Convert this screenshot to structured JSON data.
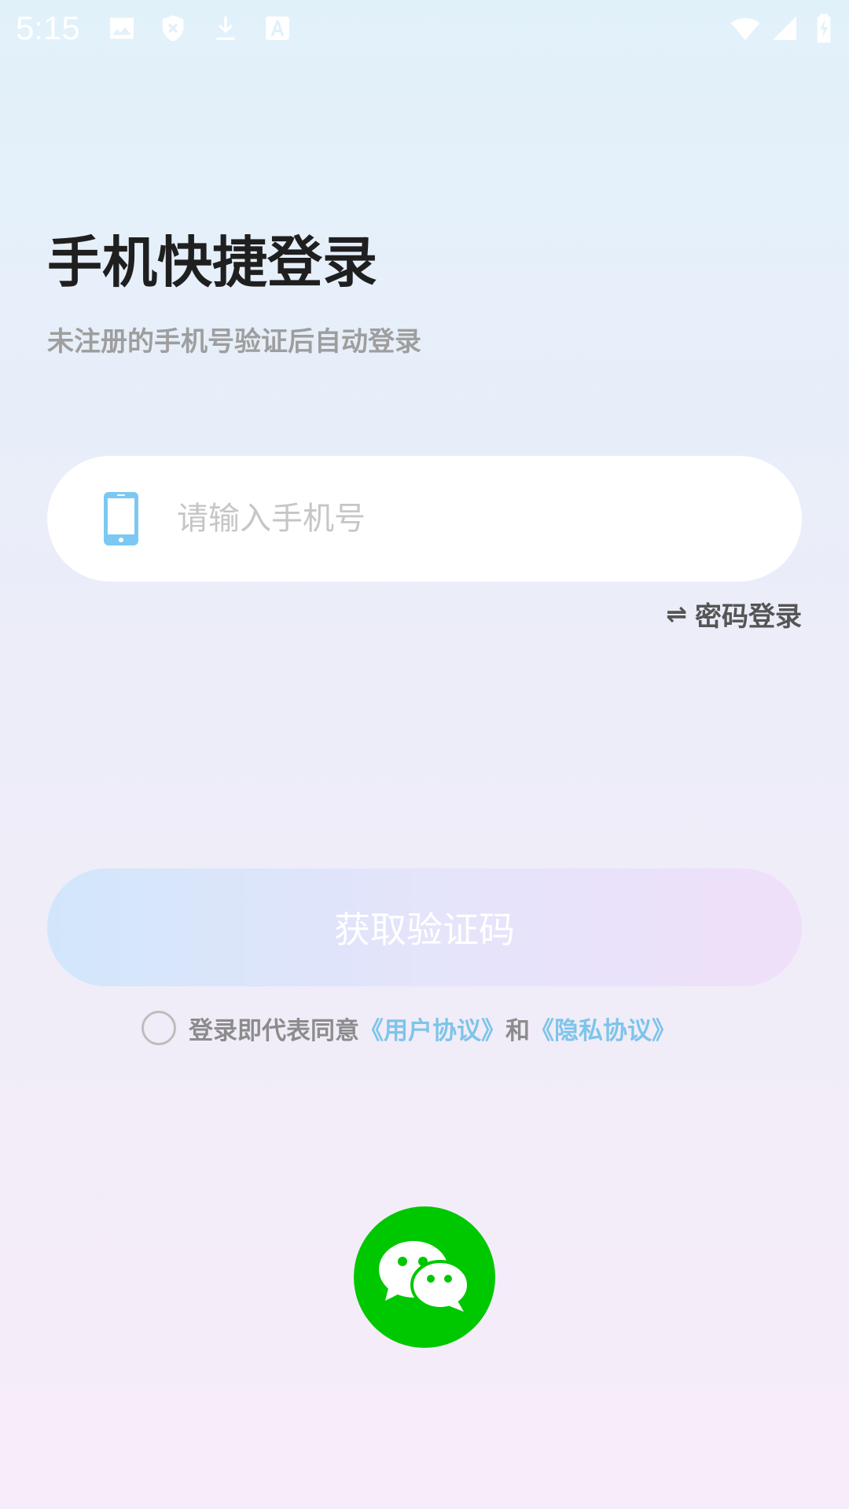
{
  "status_bar": {
    "time": "5:15",
    "left_icons": [
      "image-icon",
      "shield-x-icon",
      "download-icon",
      "font-a-icon"
    ],
    "right_icons": [
      "wifi-icon",
      "cellular-signal-icon",
      "battery-charging-icon"
    ]
  },
  "header": {
    "title": "手机快捷登录",
    "subtitle": "未注册的手机号验证后自动登录"
  },
  "phone_input": {
    "icon": "phone-icon",
    "placeholder": "请输入手机号",
    "value": ""
  },
  "switch_login": {
    "icon": "swap-icon",
    "icon_glyph": "⇌",
    "label": "密码登录"
  },
  "get_code_button": {
    "label": "获取验证码"
  },
  "agreement": {
    "checked": false,
    "prefix": "登录即代表同意",
    "user_agreement": "《用户协议》",
    "conjunction": "和",
    "privacy_agreement": "《隐私协议》"
  },
  "third_party": {
    "icon": "wechat-icon"
  },
  "colors": {
    "accent_link": "#7ec4ea",
    "wechat_green": "#00c800",
    "phone_icon_blue": "#7cc8f2",
    "title": "#1f1f1f",
    "subtitle": "#9e9e9e"
  }
}
